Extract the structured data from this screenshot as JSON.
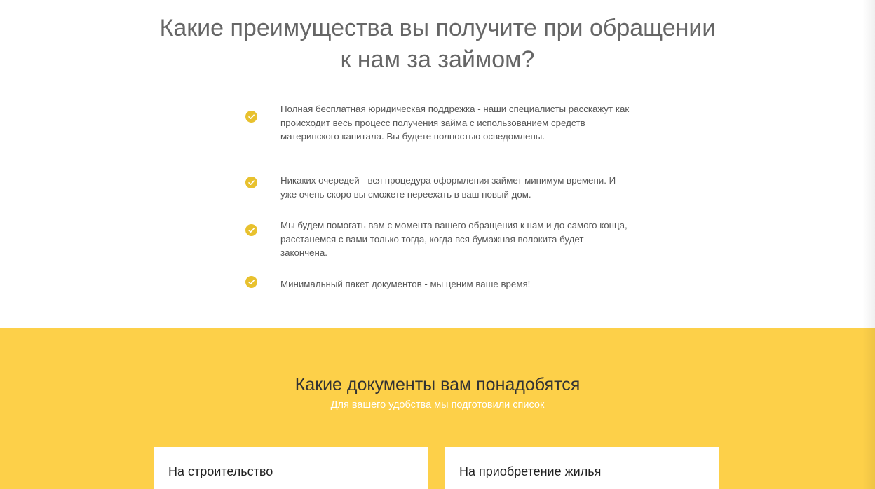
{
  "benefits": {
    "title_line1": "Какие преимущества вы получите при обращении",
    "title_line2": "к нам за займом?",
    "items": [
      {
        "icon": "check-circle-icon",
        "text": "Полная бесплатная юридическая поддрежка - наши специалисты расскажут как происходит весь процесс получения займа с использованием средств материнского капитала. Вы будете полностью осведомлены."
      },
      {
        "icon": "check-circle-icon",
        "text": "Никаких очередей - вся процедура оформления займет минимум времени. И уже очень скоро вы сможете переехать в ваш новый дом."
      },
      {
        "icon": "check-circle-icon",
        "text": "Мы будем помогать вам с момента вашего обращения к нам и до самого конца, расстанемся с вами только тогда, когда вся бумажная волокита будет закончена."
      },
      {
        "icon": "check-circle-icon",
        "text": "Минимальный пакет документов - мы ценим ваше время!"
      }
    ]
  },
  "documents": {
    "title": "Какие документы вам понадобятся",
    "subtitle": "Для вашего удобства мы подготовили список",
    "cards": [
      {
        "title": "На строительство"
      },
      {
        "title": "На приобретение жилья"
      }
    ]
  },
  "colors": {
    "accent_yellow": "#fdd049",
    "check_yellow": "#e8c12e",
    "heading_gray": "#666666"
  }
}
